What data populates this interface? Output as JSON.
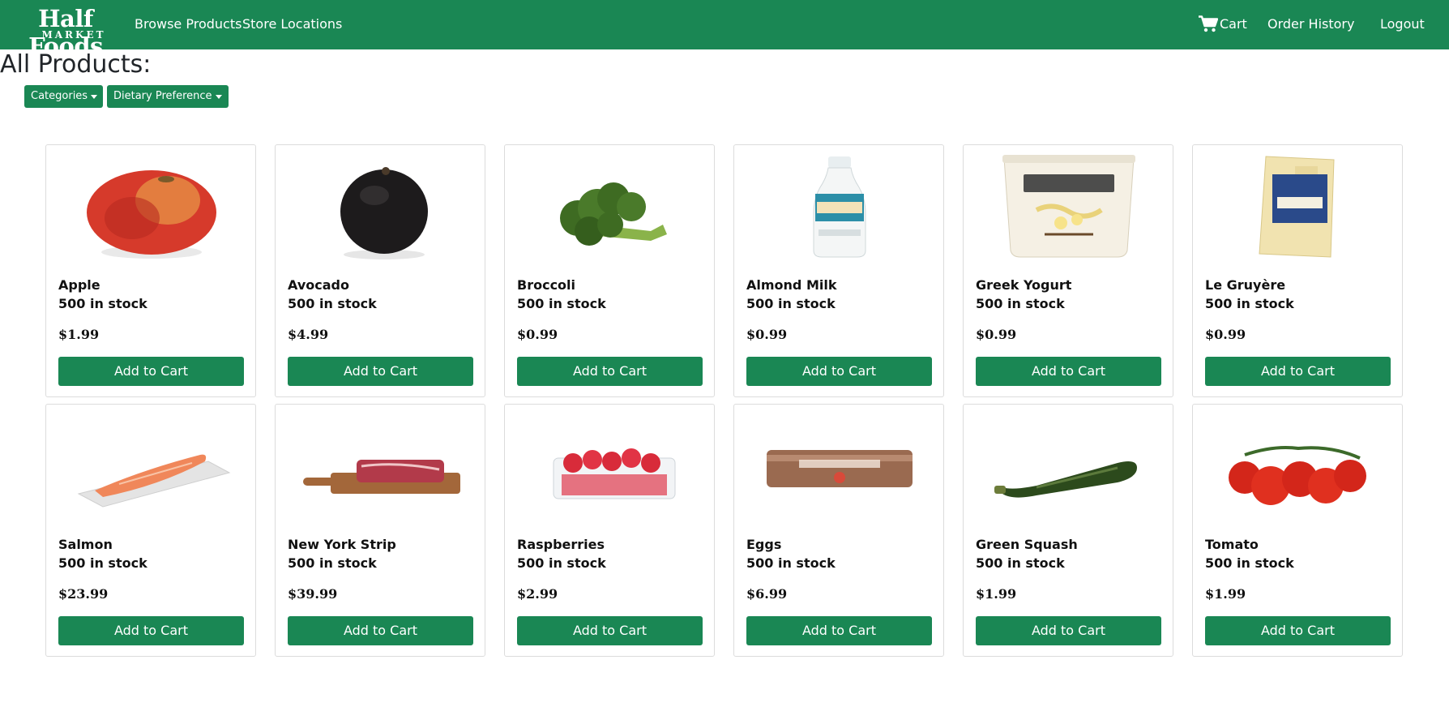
{
  "nav": {
    "brand_main": "Half Foods",
    "brand_sub": "MARKET",
    "browse_label": "Browse Products",
    "stores_label": "Store Locations",
    "cart_label": "Cart",
    "orders_label": "Order History",
    "logout_label": "Logout",
    "cart_icon": "cart-icon"
  },
  "page": {
    "title": "All Products:",
    "filters": {
      "categories_label": "Categories",
      "dietary_label": "Dietary Preference"
    }
  },
  "colors": {
    "brand_green": "#1a8754",
    "card_border": "#dcdcdc"
  },
  "products": [
    {
      "name": "Apple",
      "stock": "500 in stock",
      "price": "$1.99",
      "button": "Add to Cart",
      "image": "apple-image"
    },
    {
      "name": "Avocado",
      "stock": "500 in stock",
      "price": "$4.99",
      "button": "Add to Cart",
      "image": "avocado-image"
    },
    {
      "name": "Broccoli",
      "stock": "500 in stock",
      "price": "$0.99",
      "button": "Add to Cart",
      "image": "broccoli-image"
    },
    {
      "name": "Almond Milk",
      "stock": "500 in stock",
      "price": "$0.99",
      "button": "Add to Cart",
      "image": "almond-milk-image"
    },
    {
      "name": "Greek Yogurt",
      "stock": "500 in stock",
      "price": "$0.99",
      "button": "Add to Cart",
      "image": "greek-yogurt-image"
    },
    {
      "name": "Le Gruyère",
      "stock": "500 in stock",
      "price": "$0.99",
      "button": "Add to Cart",
      "image": "gruyere-image"
    },
    {
      "name": "Salmon",
      "stock": "500 in stock",
      "price": "$23.99",
      "button": "Add to Cart",
      "image": "salmon-image"
    },
    {
      "name": "New York Strip",
      "stock": "500 in stock",
      "price": "$39.99",
      "button": "Add to Cart",
      "image": "steak-image"
    },
    {
      "name": "Raspberries",
      "stock": "500 in stock",
      "price": "$2.99",
      "button": "Add to Cart",
      "image": "raspberries-image"
    },
    {
      "name": "Eggs",
      "stock": "500 in stock",
      "price": "$6.99",
      "button": "Add to Cart",
      "image": "eggs-image"
    },
    {
      "name": "Green Squash",
      "stock": "500 in stock",
      "price": "$1.99",
      "button": "Add to Cart",
      "image": "green-squash-image"
    },
    {
      "name": "Tomato",
      "stock": "500 in stock",
      "price": "$1.99",
      "button": "Add to Cart",
      "image": "tomato-image"
    }
  ]
}
